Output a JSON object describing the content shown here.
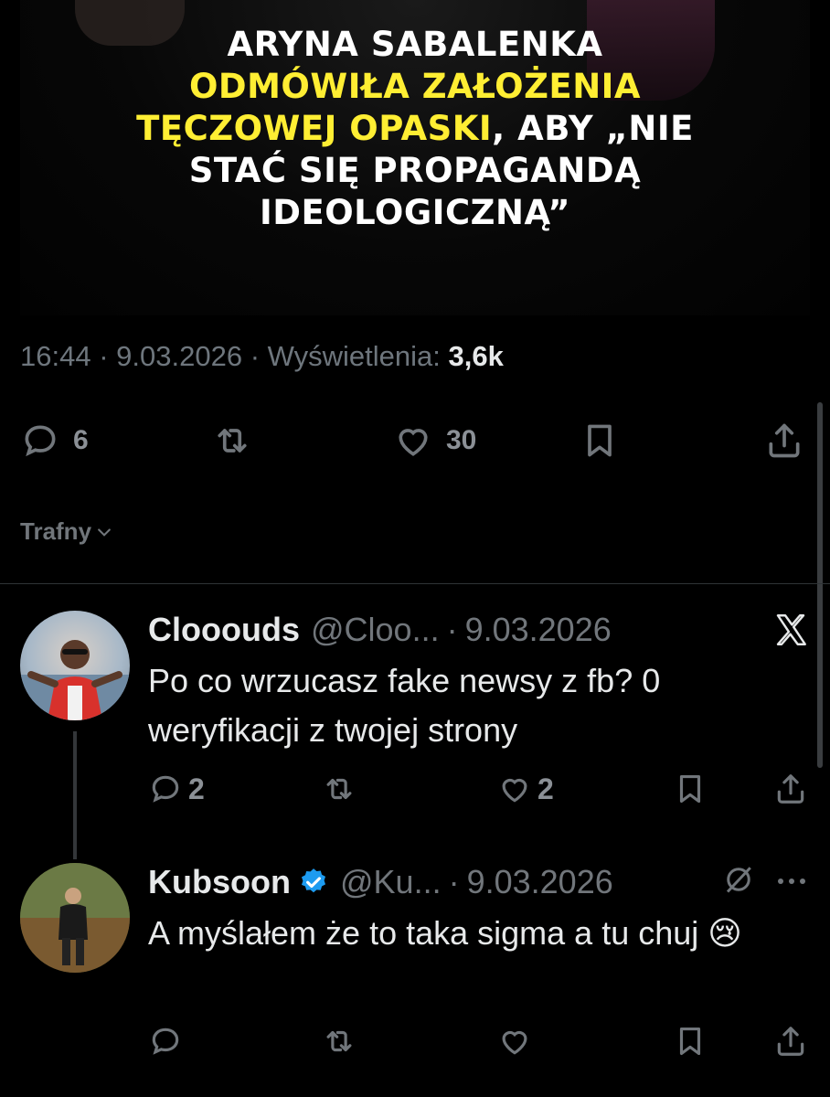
{
  "post": {
    "headline": {
      "line1": "ARYNA SABALENKA",
      "line2": "ODMÓWIŁA ZAŁOŻENIA",
      "line3_highlight": "TĘCZOWEJ OPASKI",
      "line3_rest": ", ABY „NIE",
      "line4": "STAĆ SIĘ PROPAGANDĄ",
      "line5": "IDEOLOGICZNĄ”"
    },
    "time": "16:44",
    "date": "9.03.2026",
    "views_label": "Wyświetlenia:",
    "views_count": "3,6k",
    "separator": "·",
    "actions": {
      "replies": "6",
      "reposts": "",
      "likes": "30"
    }
  },
  "sort": {
    "label": "Trafny"
  },
  "replies": [
    {
      "name": "Clooouds",
      "handle": "@Cloo...",
      "date": "9.03.2026",
      "text": "Po co wrzucasz fake newsy z fb? 0 weryfikacji z twojej strony",
      "verified": false,
      "counts": {
        "replies": "2",
        "reposts": "",
        "likes": "2"
      }
    },
    {
      "name": "Kubsoon",
      "handle": "@Ku...",
      "date": "9.03.2026",
      "text": "A myślałem że to taka sigma a tu chuj 😢",
      "verified": true,
      "counts": {
        "replies": "",
        "reposts": "",
        "likes": ""
      }
    }
  ],
  "colors": {
    "accent": "#1d9bf0",
    "highlight": "#ffee33",
    "muted": "#71767b"
  }
}
